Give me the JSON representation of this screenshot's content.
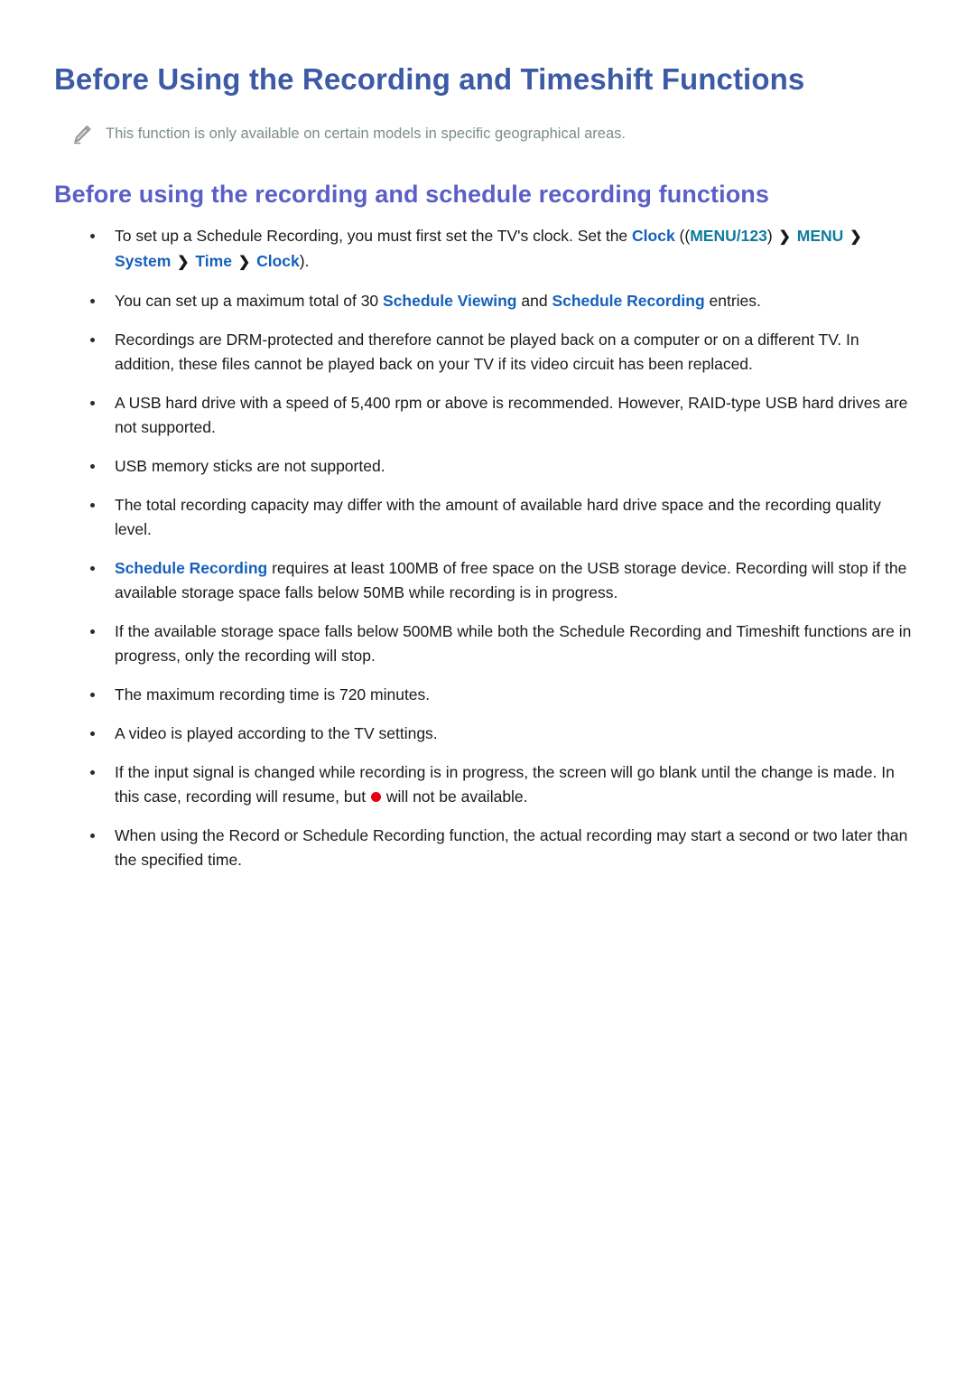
{
  "document": {
    "title": "Before Using the Recording and Timeshift Functions",
    "note": {
      "icon": "pencil-icon",
      "text": "This function is only available on certain models in specific geographical areas."
    },
    "section": {
      "heading": "Before using the recording and schedule recording functions"
    }
  },
  "colors": {
    "page_title": "#3d5aa6",
    "section_heading": "#5a5fc6",
    "keyword_blue": "#1560bd",
    "keyword_teal": "#0f7b9c",
    "note_text": "#7c8c8c",
    "body_text": "#1a1a1a",
    "record_dot": "#e60012",
    "background": "#ffffff"
  },
  "bullets": [
    {
      "id": "clock-setup",
      "parts": [
        {
          "type": "text",
          "value": "To set up a Schedule Recording, you must first set the TV's clock. Set the "
        },
        {
          "type": "kw-blue",
          "value": "Clock"
        },
        {
          "type": "text",
          "value": " (("
        },
        {
          "type": "kw-teal",
          "value": "MENU/123"
        },
        {
          "type": "text",
          "value": ") "
        },
        {
          "type": "chevron",
          "value": "❯"
        },
        {
          "type": "text",
          "value": " "
        },
        {
          "type": "kw-teal",
          "value": "MENU"
        },
        {
          "type": "text",
          "value": " "
        },
        {
          "type": "chevron",
          "value": "❯"
        },
        {
          "type": "text",
          "value": " "
        },
        {
          "type": "kw-blue",
          "value": "System"
        },
        {
          "type": "text",
          "value": " "
        },
        {
          "type": "chevron",
          "value": "❯"
        },
        {
          "type": "text",
          "value": " "
        },
        {
          "type": "kw-blue",
          "value": "Time"
        },
        {
          "type": "text",
          "value": " "
        },
        {
          "type": "chevron",
          "value": "❯"
        },
        {
          "type": "text",
          "value": " "
        },
        {
          "type": "kw-blue",
          "value": "Clock"
        },
        {
          "type": "text",
          "value": ")."
        }
      ]
    },
    {
      "id": "max-entries",
      "parts": [
        {
          "type": "text",
          "value": "You can set up a maximum total of 30 "
        },
        {
          "type": "kw-blue",
          "value": "Schedule Viewing"
        },
        {
          "type": "text",
          "value": " and "
        },
        {
          "type": "kw-blue",
          "value": "Schedule Recording"
        },
        {
          "type": "text",
          "value": " entries."
        }
      ]
    },
    {
      "id": "drm-protected",
      "parts": [
        {
          "type": "text",
          "value": "Recordings are DRM-protected and therefore cannot be played back on a computer or on a different TV. In addition, these files cannot be played back on your TV if its video circuit has been replaced."
        }
      ]
    },
    {
      "id": "usb-hard-drive",
      "parts": [
        {
          "type": "text",
          "value": "A USB hard drive with a speed of 5,400 rpm or above is recommended. However, RAID-type USB hard drives are not supported."
        }
      ]
    },
    {
      "id": "usb-memory-sticks",
      "parts": [
        {
          "type": "text",
          "value": "USB memory sticks are not supported."
        }
      ]
    },
    {
      "id": "recording-capacity",
      "parts": [
        {
          "type": "text",
          "value": "The total recording capacity may differ with the amount of available hard drive space and the recording quality level."
        }
      ]
    },
    {
      "id": "free-space-requirement",
      "parts": [
        {
          "type": "kw-blue",
          "value": "Schedule Recording"
        },
        {
          "type": "text",
          "value": " requires at least 100MB of free space on the USB storage device. Recording will stop if the available storage space falls below 50MB while recording is in progress."
        }
      ]
    },
    {
      "id": "timeshift-500mb",
      "parts": [
        {
          "type": "text",
          "value": "If the available storage space falls below 500MB while both the Schedule Recording and Timeshift functions are in progress, only the recording will stop."
        }
      ]
    },
    {
      "id": "max-recording-time",
      "parts": [
        {
          "type": "text",
          "value": "The maximum recording time is 720 minutes."
        }
      ]
    },
    {
      "id": "video-playback-settings",
      "parts": [
        {
          "type": "text",
          "value": "A video is played according to the TV settings."
        }
      ]
    },
    {
      "id": "input-signal-change",
      "parts": [
        {
          "type": "text",
          "value": "If the input signal is changed while recording is in progress, the screen will go blank until the change is made. In this case, recording will resume, but "
        },
        {
          "type": "record-dot",
          "value": ""
        },
        {
          "type": "text",
          "value": " will not be available."
        }
      ]
    },
    {
      "id": "recording-start-delay",
      "parts": [
        {
          "type": "text",
          "value": "When using the Record or Schedule Recording function, the actual recording may start a second or two later than the specified time."
        }
      ]
    }
  ]
}
